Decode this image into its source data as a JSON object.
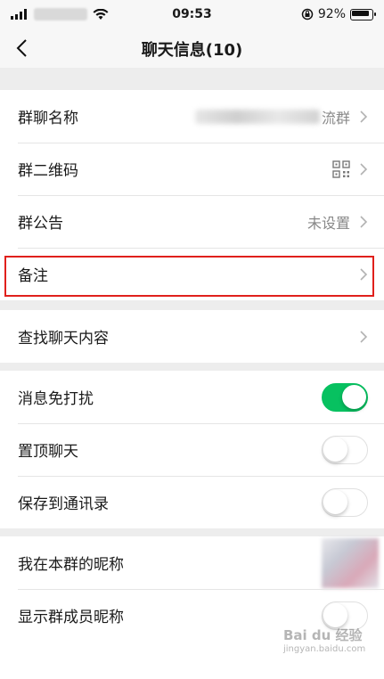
{
  "status_bar": {
    "time": "09:53",
    "battery": "92%"
  },
  "nav": {
    "title": "聊天信息(10)"
  },
  "group1": {
    "name_label": "群聊名称",
    "name_value_suffix": "流群",
    "qrcode_label": "群二维码",
    "notice_label": "群公告",
    "notice_value": "未设置",
    "remark_label": "备注"
  },
  "group2": {
    "search_label": "查找聊天内容"
  },
  "group3": {
    "mute_label": "消息免打扰",
    "mute_on": true,
    "pin_label": "置顶聊天",
    "pin_on": false,
    "save_label": "保存到通讯录",
    "save_on": false
  },
  "group4": {
    "nickname_label": "我在本群的昵称",
    "show_nicknames_label": "显示群成员昵称",
    "show_nicknames_on": false
  },
  "watermark": {
    "line1": "Bai du 经验",
    "line2": "jingyan.baidu.com"
  },
  "colors": {
    "toggle_on": "#07c160",
    "highlight": "#e0201c"
  }
}
